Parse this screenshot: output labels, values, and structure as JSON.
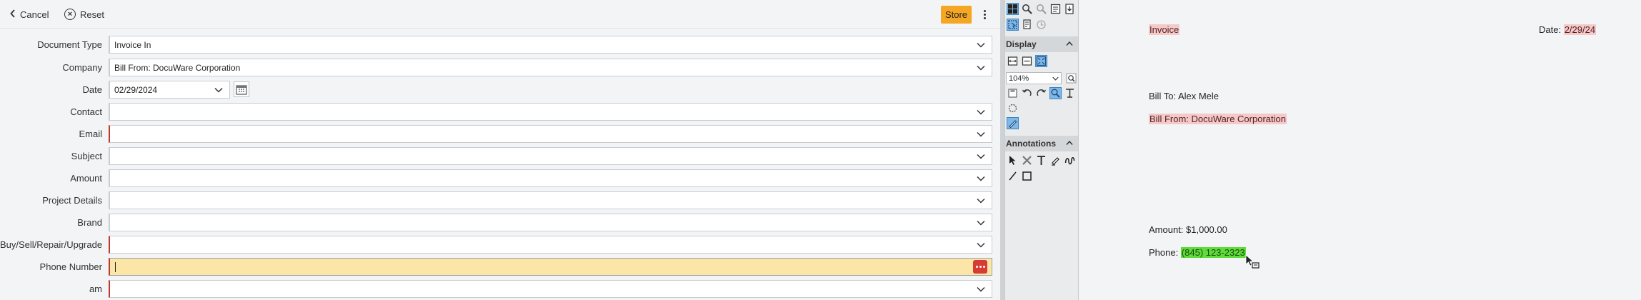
{
  "toolbar": {
    "cancel_label": "Cancel",
    "reset_label": "Reset",
    "store_label": "Store"
  },
  "form": {
    "fields": [
      {
        "label": "Document Type",
        "value": "Invoice In",
        "required": false
      },
      {
        "label": "Company",
        "value": "Bill From: DocuWare Corporation",
        "required": false
      },
      {
        "label": "Date",
        "value": "02/29/2024",
        "required": false
      },
      {
        "label": "Contact",
        "value": "",
        "required": false
      },
      {
        "label": "Email",
        "value": "",
        "required": true
      },
      {
        "label": "Subject",
        "value": "",
        "required": false
      },
      {
        "label": "Amount",
        "value": "",
        "required": false
      },
      {
        "label": "Project Details",
        "value": "",
        "required": false
      },
      {
        "label": "Brand",
        "value": "",
        "required": false
      },
      {
        "label": "Buy/Sell/Repair/Upgrade",
        "value": "",
        "required": true
      },
      {
        "label": "Phone Number",
        "value": "",
        "required": true
      },
      {
        "label": "am",
        "value": "",
        "required": true
      }
    ]
  },
  "tools": {
    "display_label": "Display",
    "annotations_label": "Annotations",
    "zoom_value": "104%"
  },
  "document": {
    "title": "Invoice",
    "date_label": "Date: ",
    "date_value": "2/29/24",
    "bill_to": "Bill To: Alex Mele",
    "bill_from": "Bill From: DocuWare Corporation",
    "amount": "Amount: $1,000.00",
    "phone_label": "Phone: ",
    "phone_value": "(845) 123-2323"
  },
  "colors": {
    "store_button": "#f5a623",
    "required_marker": "#c0392b",
    "focused_field": "#fbe6a8",
    "highlight_red": "#f3c9c9",
    "highlight_green": "#5fdc3a"
  },
  "icons": [
    "chevron-left-icon",
    "reset-circle-icon",
    "more-vertical-icon",
    "chevron-down-icon",
    "calendar-icon",
    "ellipsis-icon",
    "thumbnails-icon",
    "zoom-icon",
    "zoom-area-icon",
    "fit-page-icon",
    "export-icon",
    "select-icon",
    "copy-icon",
    "history-icon",
    "fit-width-icon",
    "fit-height-icon",
    "fit-window-icon",
    "magnifier-icon",
    "save-icon",
    "rotate-left-icon",
    "rotate-right-icon",
    "pan-icon",
    "text-select-icon",
    "lasso-icon",
    "pen-icon",
    "pointer-icon",
    "delete-icon",
    "text-icon",
    "highlighter-icon",
    "freehand-icon",
    "line-icon",
    "rectangle-icon",
    "cursor-icon"
  ]
}
